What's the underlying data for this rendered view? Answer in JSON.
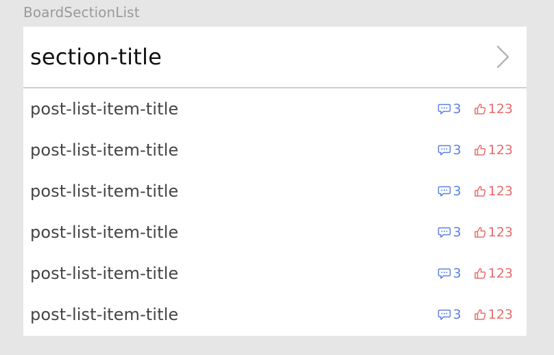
{
  "component_label": "BoardSectionList",
  "section": {
    "title": "section-title",
    "chevron_icon": "chevron-right-icon"
  },
  "colors": {
    "comment": "#5b7fe2",
    "like": "#ea6a6a",
    "divider": "#cfcfcf",
    "background": "#e6e6e6"
  },
  "posts": [
    {
      "title": "post-list-item-title",
      "comments": "3",
      "likes": "123"
    },
    {
      "title": "post-list-item-title",
      "comments": "3",
      "likes": "123"
    },
    {
      "title": "post-list-item-title",
      "comments": "3",
      "likes": "123"
    },
    {
      "title": "post-list-item-title",
      "comments": "3",
      "likes": "123"
    },
    {
      "title": "post-list-item-title",
      "comments": "3",
      "likes": "123"
    },
    {
      "title": "post-list-item-title",
      "comments": "3",
      "likes": "123"
    }
  ]
}
